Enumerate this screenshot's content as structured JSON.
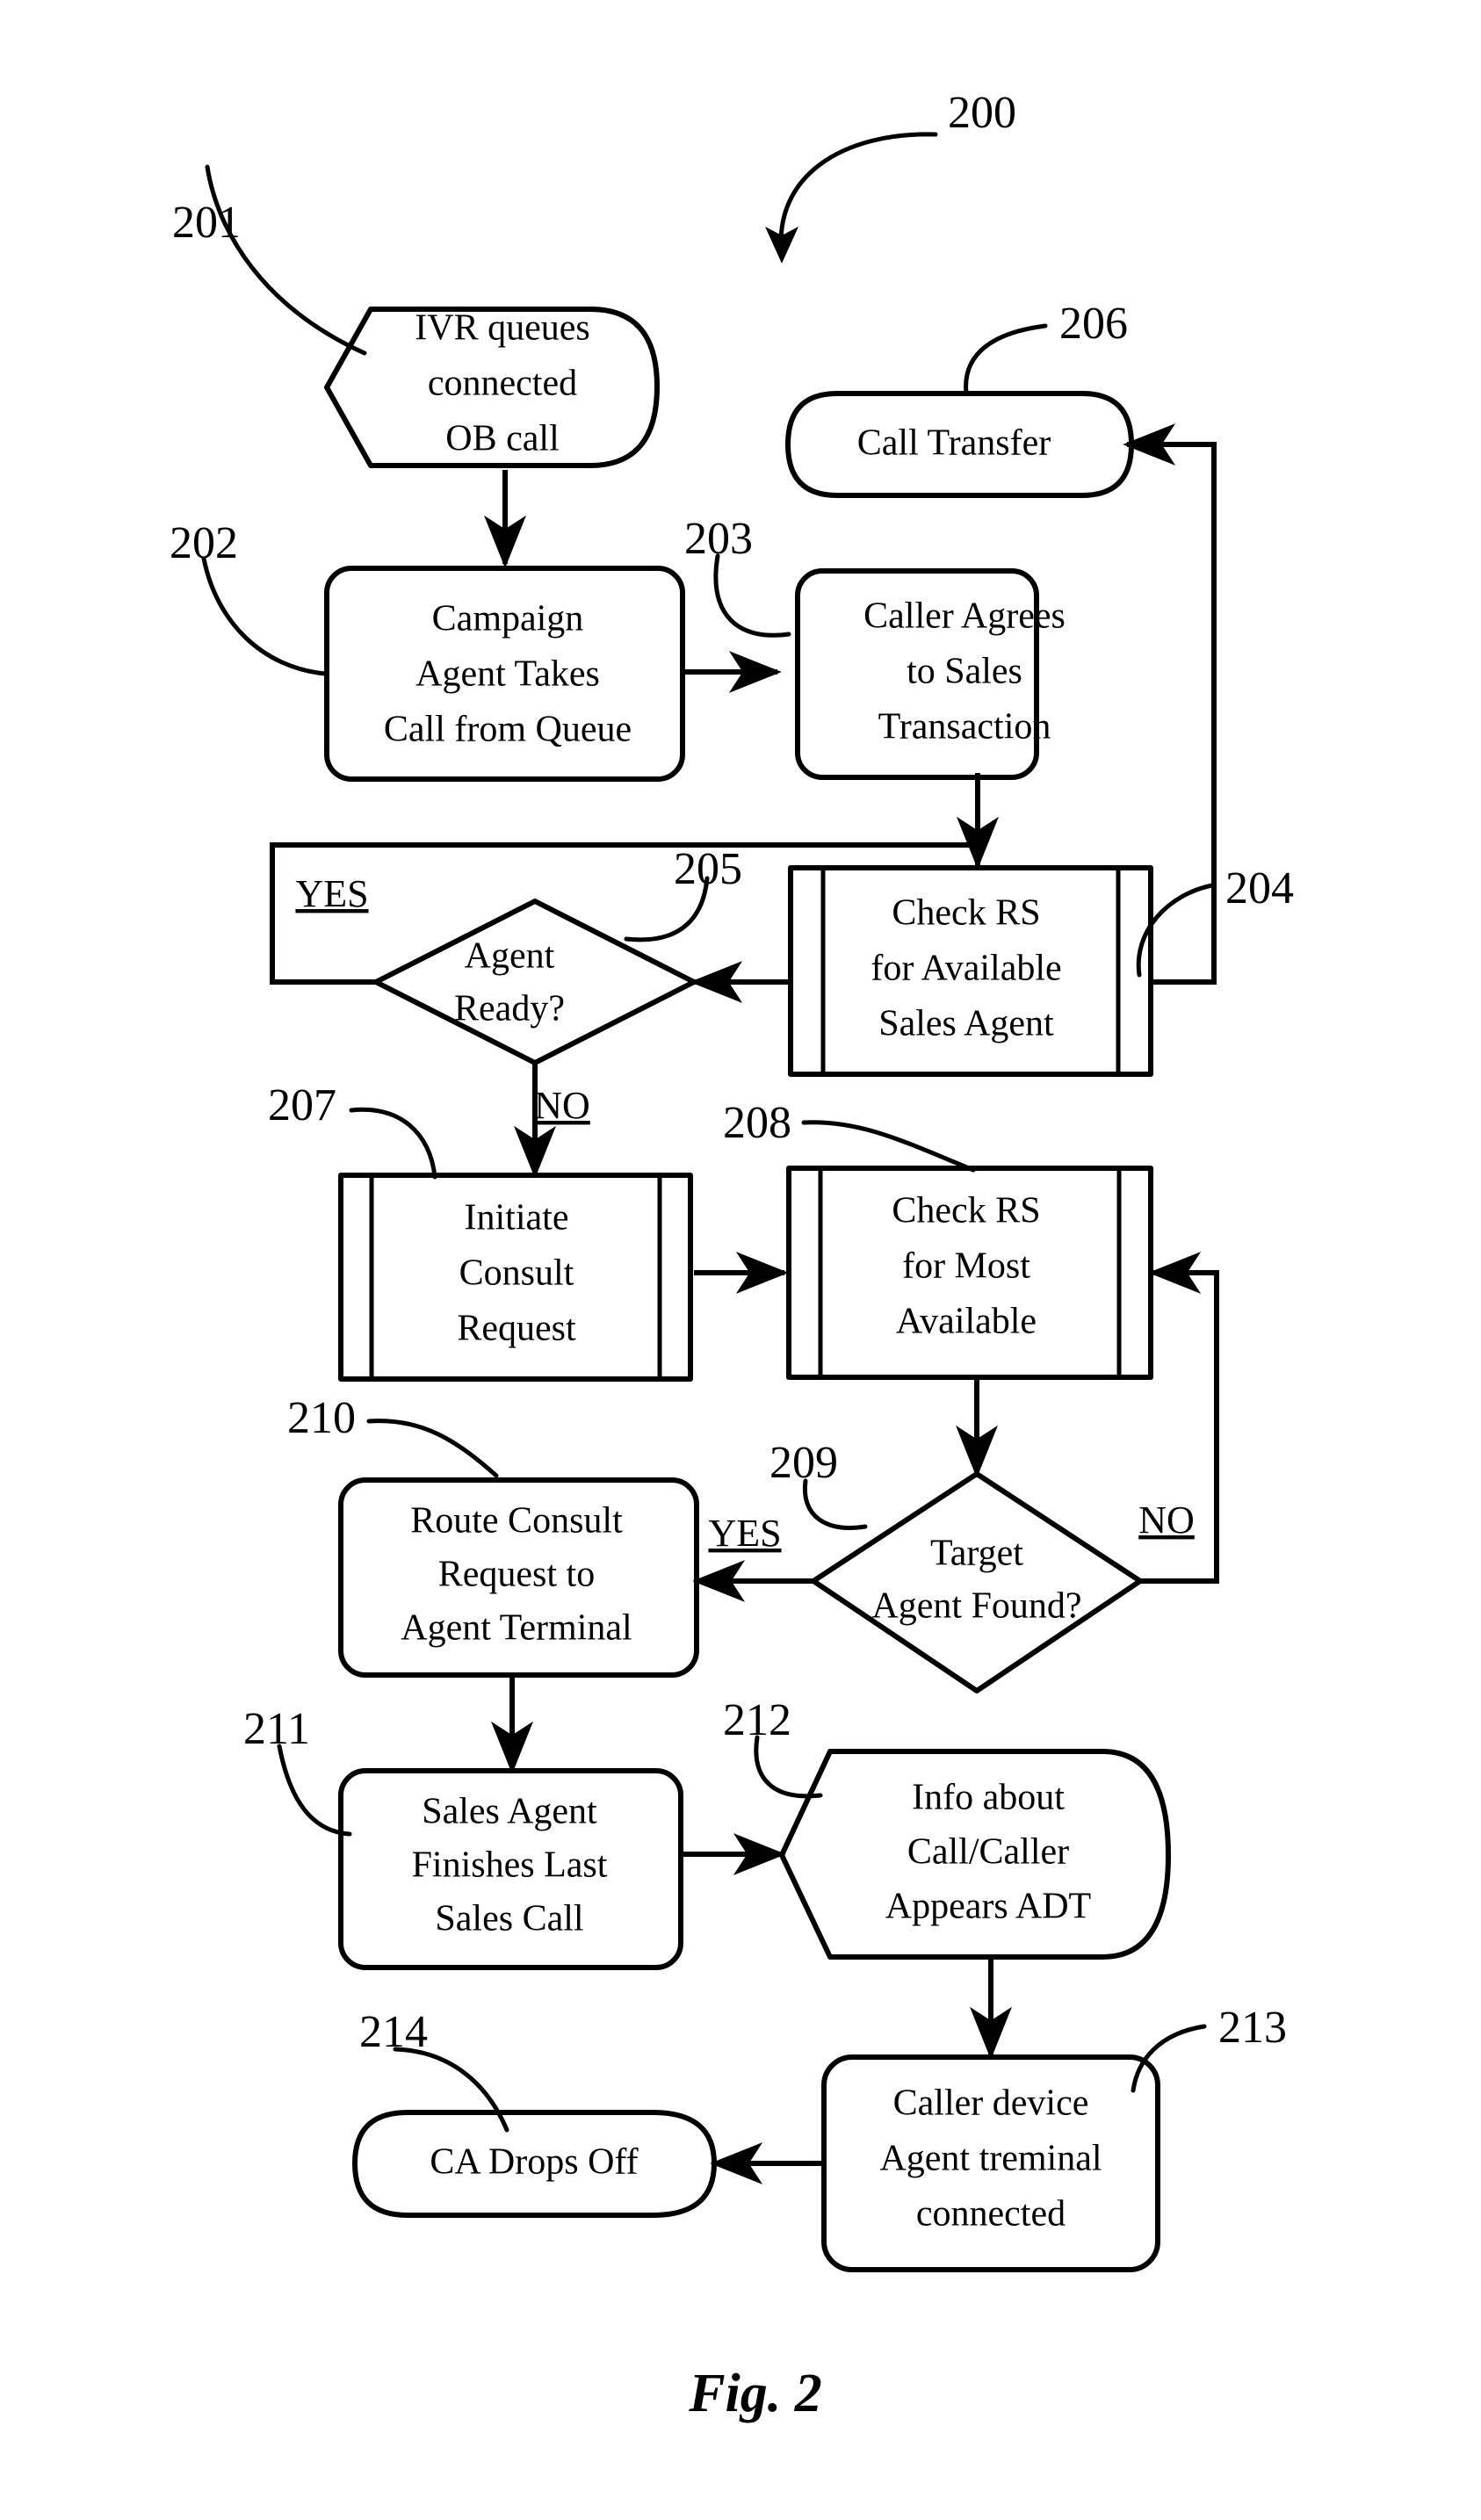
{
  "figure": {
    "caption": "Fig. 2",
    "diagram_ref": "200"
  },
  "nodes": [
    {
      "ref": "201",
      "shape": "pentagon-rounded",
      "lines": [
        "IVR queues",
        "connected",
        "OB call"
      ]
    },
    {
      "ref": "206",
      "shape": "stadium",
      "lines": [
        "Call Transfer"
      ]
    },
    {
      "ref": "202",
      "shape": "rounded-rect",
      "lines": [
        "Campaign",
        "Agent Takes",
        "Call from Queue"
      ]
    },
    {
      "ref": "203",
      "shape": "rounded-rect",
      "lines": [
        "Caller Agrees",
        "to Sales",
        "Transaction"
      ]
    },
    {
      "ref": "204",
      "shape": "predefined-process",
      "lines": [
        "Check RS",
        "for Available",
        "Sales Agent"
      ]
    },
    {
      "ref": "205",
      "shape": "diamond",
      "lines": [
        "Agent",
        "Ready?"
      ]
    },
    {
      "ref": "207",
      "shape": "predefined-process",
      "lines": [
        "Initiate",
        "Consult",
        "Request"
      ]
    },
    {
      "ref": "208",
      "shape": "predefined-process",
      "lines": [
        "Check RS",
        "for Most",
        "Available"
      ]
    },
    {
      "ref": "209",
      "shape": "diamond",
      "lines": [
        "Target",
        "Agent Found?"
      ]
    },
    {
      "ref": "210",
      "shape": "rounded-rect",
      "lines": [
        "Route Consult",
        "Request to",
        "Agent Terminal"
      ]
    },
    {
      "ref": "211",
      "shape": "rounded-rect",
      "lines": [
        "Sales Agent",
        "Finishes Last",
        "Sales Call"
      ]
    },
    {
      "ref": "212",
      "shape": "pentagon-rounded",
      "lines": [
        "Info about",
        "Call/Caller",
        "Appears ADT"
      ]
    },
    {
      "ref": "213",
      "shape": "rounded-rect",
      "lines": [
        "Caller device",
        "Agent treminal",
        "connected"
      ]
    },
    {
      "ref": "214",
      "shape": "stadium",
      "lines": [
        "CA Drops Off"
      ]
    }
  ],
  "branch_labels": {
    "agent_ready_yes": "YES",
    "agent_ready_no": "NO",
    "target_found_yes": "YES",
    "target_found_no": "NO"
  },
  "colors": {
    "stroke": "#000000",
    "background": "#ffffff"
  }
}
